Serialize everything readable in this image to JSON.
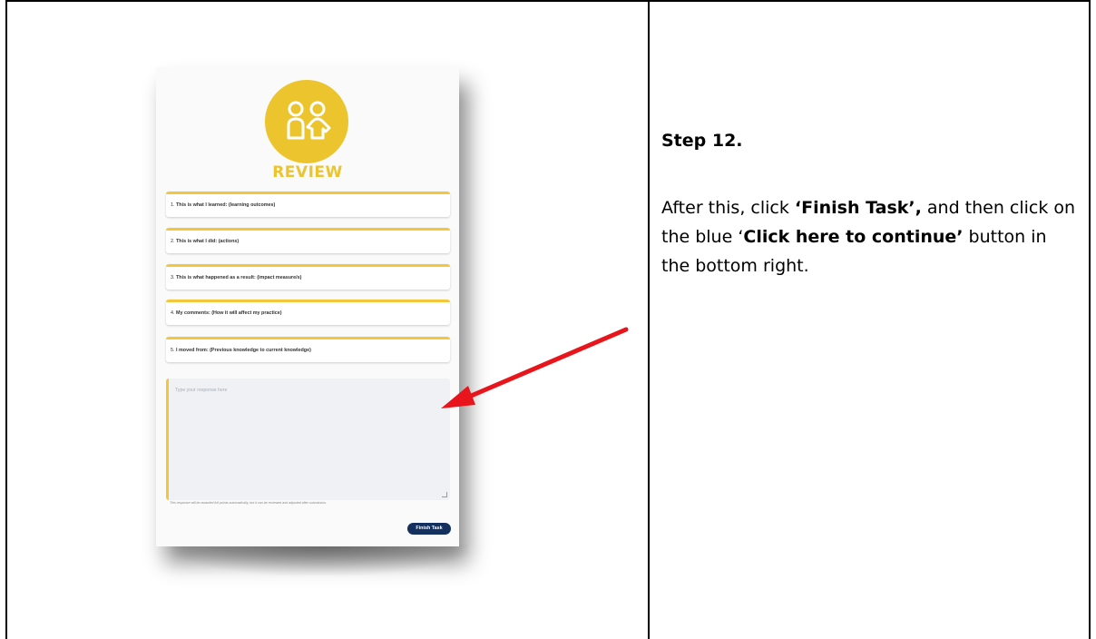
{
  "screenshot": {
    "review_heading": "REVIEW",
    "questions": [
      {
        "number": "1.",
        "label": "This is what I learned: (learning outcomes)"
      },
      {
        "number": "2.",
        "label": "This is what I did: (actions)"
      },
      {
        "number": "3.",
        "label": "This is what happened as a result: (impact measure/s)"
      },
      {
        "number": "4.",
        "label": "My comments: (How it will affect my practice)"
      },
      {
        "number": "5.",
        "label": "I moved from: (Previous knowledge to current knowledge)"
      }
    ],
    "response_placeholder": "Type your response here",
    "note": "This response will be awarded full points automatically, but it can be reviewed and adjusted after submission.",
    "finish_button": "Finish Task",
    "accent_color": "#ecc42e",
    "button_color": "#14305e",
    "arrow_color": "#e8151c"
  },
  "step": {
    "title": "Step 12.",
    "text_1": "After this, click ",
    "bold_1": "‘Finish Task’,",
    "text_2": " and then click on the blue ‘",
    "bold_2": "Click here to continue’",
    "text_3": " button in the bottom right."
  }
}
